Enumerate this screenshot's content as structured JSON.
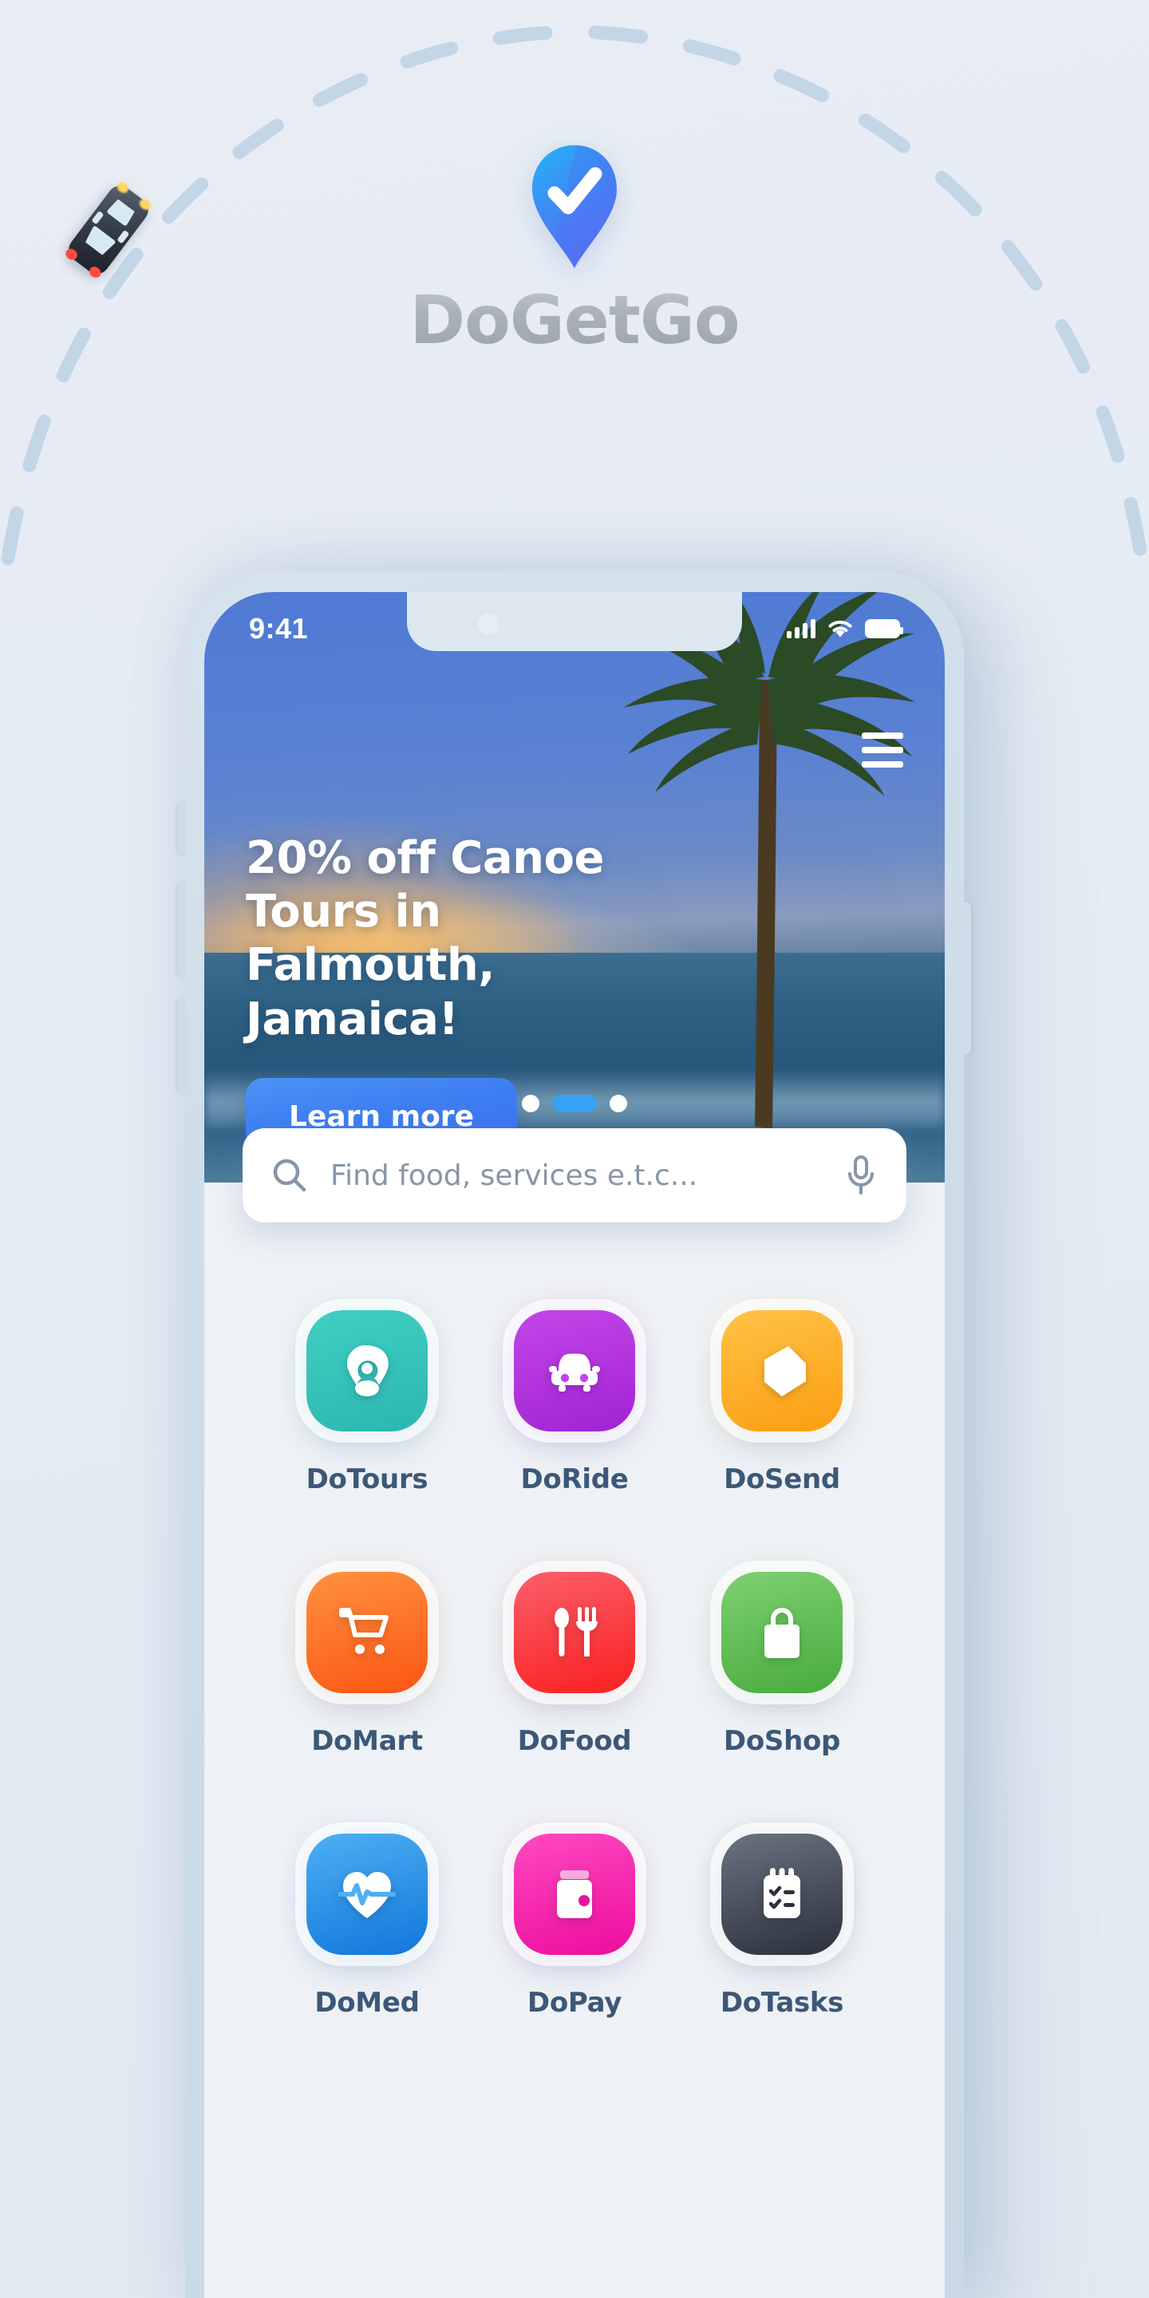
{
  "brand": {
    "title": "DoGetGo",
    "logo_icon": "map-pin-check-icon",
    "car_icon": "car-top-view-icon"
  },
  "phone": {
    "statusbar": {
      "time": "9:41",
      "signal_icon": "cellular-signal-icon",
      "wifi_icon": "wifi-icon",
      "battery_icon": "battery-full-icon"
    },
    "menu_icon": "hamburger-menu-icon"
  },
  "hero": {
    "title": "20% off Canoe Tours in Falmouth, Jamaica!",
    "cta_label": "Learn more",
    "carousel": {
      "total": 3,
      "active_index": 1
    },
    "accent_color": "#3d7ef2",
    "dot_active_color": "#35a2f5"
  },
  "search": {
    "placeholder": "Find food, services e.t.c...",
    "value": "",
    "search_icon": "search-icon",
    "mic_icon": "microphone-icon"
  },
  "apps": [
    {
      "label": "DoTours",
      "icon": "location-pin-icon",
      "color": "#41cfc0",
      "color2": "#2bb7b2"
    },
    {
      "label": "DoRide",
      "icon": "car-icon",
      "color": "#c346e8",
      "color2": "#a023d4"
    },
    {
      "label": "DoSend",
      "icon": "package-box-icon",
      "color": "#ffc247",
      "color2": "#fb9e11"
    },
    {
      "label": "DoMart",
      "icon": "shopping-cart-icon",
      "color": "#ff9140",
      "color2": "#fb5612"
    },
    {
      "label": "DoFood",
      "icon": "spoon-fork-icon",
      "color": "#fb5f6a",
      "color2": "#fa2020"
    },
    {
      "label": "DoShop",
      "icon": "shopping-bag-icon",
      "color": "#7ed171",
      "color2": "#48ab3e"
    },
    {
      "label": "DoMed",
      "icon": "heart-pulse-icon",
      "color": "#4eaff3",
      "color2": "#1177db"
    },
    {
      "label": "DoPay",
      "icon": "wallet-icon",
      "color": "#ff49c0",
      "color2": "#ec0d9e"
    },
    {
      "label": "DoTasks",
      "icon": "clipboard-check-icon",
      "color": "#6a7381",
      "color2": "#2b313b"
    }
  ]
}
